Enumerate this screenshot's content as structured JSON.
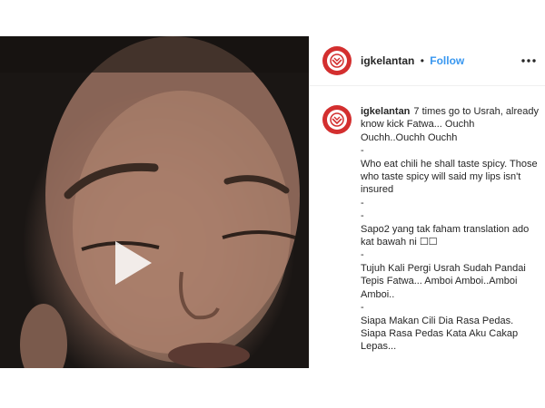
{
  "post": {
    "username": "igkelantan",
    "separator": "•",
    "follow_label": "Follow",
    "caption": {
      "first": "7 times go to Usrah, already know kick Fatwa... Ouchh Ouchh..Ouchh Ouchh",
      "lines": [
        "-",
        "Who eat chili he shall taste spicy. Those who taste spicy will said my lips isn't insured",
        "-",
        "-",
        "Sapo2 yang tak faham translation ado kat bawah ni ☐☐",
        "-",
        "Tujuh Kali Pergi Usrah Sudah Pandai Tepis Fatwa... Amboi Amboi..Amboi Amboi..",
        "-",
        "Siapa Makan Cili Dia Rasa Pedas. Siapa Rasa Pedas Kata Aku Cakap Lepas..."
      ]
    }
  },
  "icons": {
    "avatar": "igkelantan-logo-icon",
    "play": "play-icon",
    "more": "more-options-icon"
  },
  "colors": {
    "follow": "#3897f0",
    "avatar_red": "#d32f2f"
  }
}
